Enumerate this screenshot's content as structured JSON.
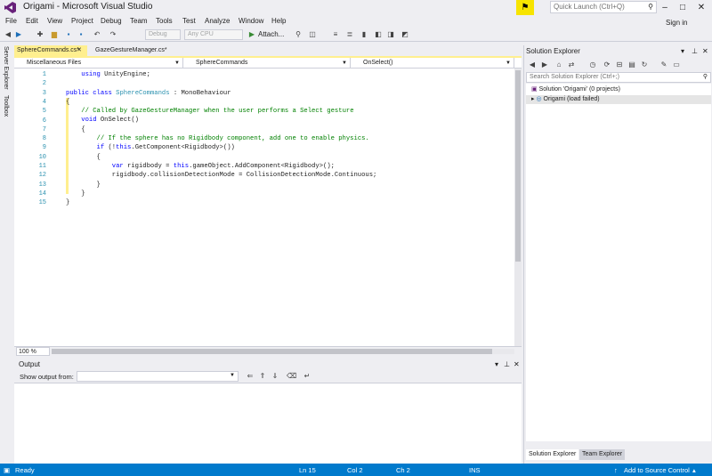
{
  "window": {
    "title": "Origami - Microsoft Visual Studio",
    "quick_launch_placeholder": "Quick Launch (Ctrl+Q)",
    "sign_in": "Sign in"
  },
  "menu": [
    "File",
    "Edit",
    "View",
    "Project",
    "Debug",
    "Team",
    "Tools",
    "Test",
    "Analyze",
    "Window",
    "Help"
  ],
  "toolbar": {
    "config": "Debug",
    "platform": "Any CPU",
    "attach": "Attach..."
  },
  "left_strip": {
    "server_explorer": "Server Explorer",
    "toolbox": "Toolbox"
  },
  "tabs": [
    {
      "label": "SphereCommands.cs*",
      "active": true
    },
    {
      "label": "GazeGestureManager.cs*",
      "active": false
    }
  ],
  "navbar": {
    "project": "Miscellaneous Files",
    "class": "SphereCommands",
    "member": "OnSelect()"
  },
  "code_lines": [
    [
      {
        "t": "    "
      },
      {
        "t": "using",
        "c": "kw"
      },
      {
        "t": " UnityEngine;"
      }
    ],
    [
      {
        "t": ""
      }
    ],
    [
      {
        "t": "public",
        "c": "kw"
      },
      {
        "t": " "
      },
      {
        "t": "class",
        "c": "kw"
      },
      {
        "t": " "
      },
      {
        "t": "SphereCommands",
        "c": "ty"
      },
      {
        "t": " : MonoBehaviour"
      }
    ],
    [
      {
        "t": "{"
      }
    ],
    [
      {
        "t": "    "
      },
      {
        "t": "// Called by GazeGestureManager when the user performs a Select gesture",
        "c": "cm"
      }
    ],
    [
      {
        "t": "    "
      },
      {
        "t": "void",
        "c": "kw"
      },
      {
        "t": " OnSelect()"
      }
    ],
    [
      {
        "t": "    {"
      }
    ],
    [
      {
        "t": "        "
      },
      {
        "t": "// If the sphere has no Rigidbody component, add one to enable physics.",
        "c": "cm"
      }
    ],
    [
      {
        "t": "        "
      },
      {
        "t": "if",
        "c": "kw"
      },
      {
        "t": " (!"
      },
      {
        "t": "this",
        "c": "kw"
      },
      {
        "t": ".GetComponent<Rigidbody>())"
      }
    ],
    [
      {
        "t": "        {"
      }
    ],
    [
      {
        "t": "            "
      },
      {
        "t": "var",
        "c": "kw"
      },
      {
        "t": " rigidbody = "
      },
      {
        "t": "this",
        "c": "kw"
      },
      {
        "t": ".gameObject.AddComponent<Rigidbody>();"
      }
    ],
    [
      {
        "t": "            rigidbody.collisionDetectionMode = CollisionDetectionMode.Continuous;"
      }
    ],
    [
      {
        "t": "        }"
      }
    ],
    [
      {
        "t": "    }"
      }
    ],
    [
      {
        "t": "}"
      }
    ]
  ],
  "editor": {
    "zoom": "100 %"
  },
  "output": {
    "title": "Output",
    "show_from": "Show output from:"
  },
  "solution_explorer": {
    "title": "Solution Explorer",
    "search_placeholder": "Search Solution Explorer (Ctrl+;)",
    "items": [
      "Solution 'Origami' (0 projects)",
      "Origami (load failed)"
    ],
    "tabs": [
      "Solution Explorer",
      "Team Explorer"
    ]
  },
  "status": {
    "ready": "Ready",
    "ln": "Ln 15",
    "col": "Col 2",
    "ch": "Ch 2",
    "ins": "INS",
    "source_control": "Add to Source Control"
  },
  "colors": {
    "accent": "#007acc",
    "tab_active": "#ffef8f",
    "keyword": "#0000ff",
    "type": "#2b91af",
    "comment": "#008000",
    "vs_purple": "#68217a"
  }
}
